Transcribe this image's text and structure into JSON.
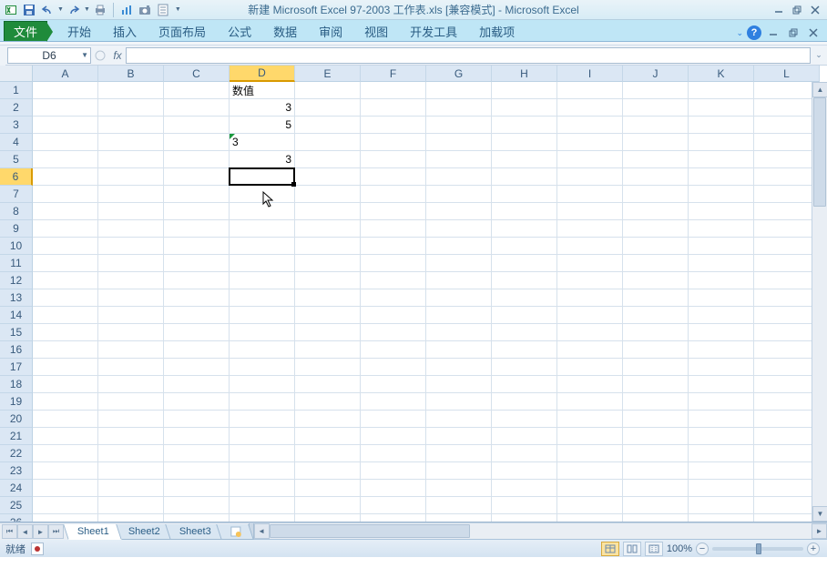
{
  "title": "新建 Microsoft Excel 97-2003 工作表.xls  [兼容模式]  -  Microsoft Excel",
  "ribbon": {
    "file": "文件",
    "tabs": [
      "开始",
      "插入",
      "页面布局",
      "公式",
      "数据",
      "审阅",
      "视图",
      "开发工具",
      "加载项"
    ]
  },
  "namebox": {
    "value": "D6"
  },
  "formula": {
    "fx": "fx",
    "value": ""
  },
  "columns": [
    "A",
    "B",
    "C",
    "D",
    "E",
    "F",
    "G",
    "H",
    "I",
    "J",
    "K",
    "L"
  ],
  "row_count": 26,
  "selected": {
    "col": "D",
    "row": 6
  },
  "cells": {
    "D1": {
      "v": "数值",
      "align": "left"
    },
    "D2": {
      "v": "3",
      "align": "right"
    },
    "D3": {
      "v": "5",
      "align": "right"
    },
    "D4": {
      "v": "3",
      "align": "left",
      "warn": true
    },
    "D5": {
      "v": "3",
      "align": "right"
    }
  },
  "sheets": {
    "list": [
      "Sheet1",
      "Sheet2",
      "Sheet3"
    ],
    "active": 0
  },
  "status": {
    "ready": "就绪",
    "zoom": "100%"
  },
  "chart_data": null
}
